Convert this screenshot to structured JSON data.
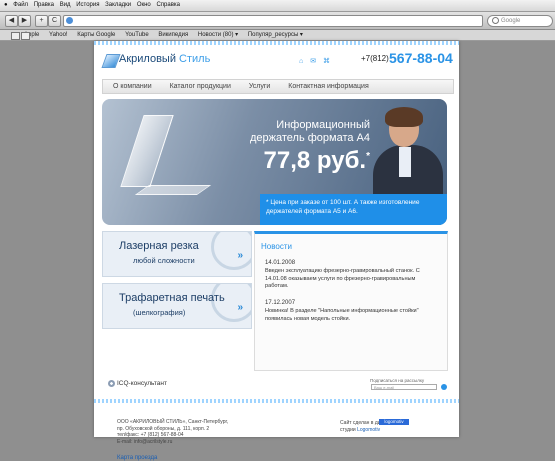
{
  "menubar": {
    "items": [
      "Файл",
      "Правка",
      "Вид",
      "История",
      "Закладки",
      "Окно",
      "Справка"
    ]
  },
  "toolbar": {
    "back": "◀",
    "forward": "▶",
    "add": "+",
    "reload": "C",
    "search_placeholder": "Google"
  },
  "bookmarks": [
    "Apple",
    "Yahoo!",
    "Карты Google",
    "YouTube",
    "Википедия",
    "Новости (80) ▾",
    "Популяр_ресурсы ▾"
  ],
  "site": {
    "logo_main": "Акриловый ",
    "logo_accent": "Стиль",
    "phone_code": "+7(812)",
    "phone_number": "567-88-04",
    "nav": [
      "О компании",
      "Каталог продукции",
      "Услуги",
      "Контактная информация"
    ],
    "banner": {
      "title_line1": "Информационный",
      "title_line2": "держатель формата А4",
      "price": "77,8 руб.",
      "price_mark": "*",
      "note": "* Цена при заказе от 100 шт. А также изготовление держателей формата А5 и А6."
    },
    "promo1": {
      "main": "Лазерная резка",
      "sub": "любой сложности",
      "arrow": "»"
    },
    "promo2": {
      "main": "Трафаретная печать",
      "sub": "(шелкография)",
      "arrow": "»"
    },
    "news": {
      "title": "Новости",
      "items": [
        {
          "date": "14.01.2008",
          "text": "Введен эксплуатацию фрезерно-гравировальный станок. С 14.01.08 оказываем услуги по фрезерно-гравировальным работам."
        },
        {
          "date": "17.12.2007",
          "text": "Новинка! В разделе \"Напольные информационные стойки\" появилась новая модель стойки."
        }
      ]
    },
    "icq": "ICQ-консультант",
    "subscribe_label": "Подписаться на рассылку",
    "email_placeholder": "Ваш e-mail",
    "footer": {
      "company_lines": [
        "ООО «АКРИЛОВЫЙ СТИЛЬ», Санкт-Петербург,",
        "пр. Обуховской обороны, д. 111, корп. 2",
        "тел/факс: +7 (812) 567-88-04",
        "E-mail: info@acrilstyle.ru"
      ],
      "map_link": "Карта проезда",
      "site_by": "Сайт сделан в дизайн-",
      "studio_prefix": "студии ",
      "studio": "Logomotiv",
      "badge": "logomotiv"
    }
  }
}
